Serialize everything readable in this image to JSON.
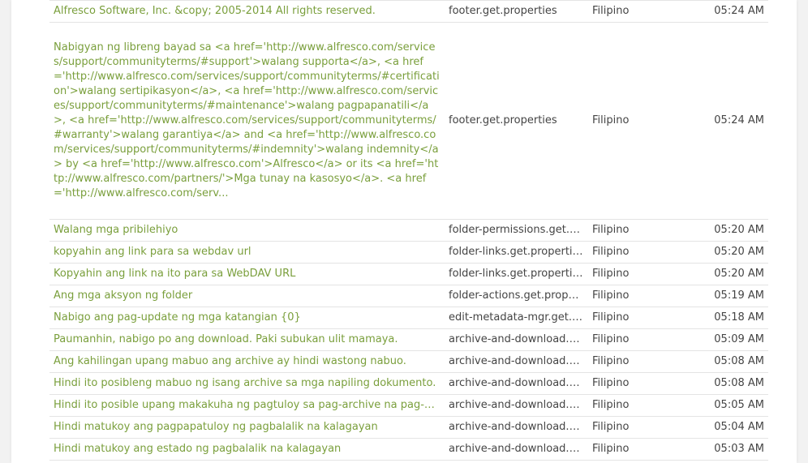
{
  "rows": [
    {
      "text": "Alfresco Software, Inc. &copy; 2005-2014 All rights reserved.",
      "bundle": "footer.get.properties",
      "language": "Filipino",
      "time": "05:24 AM"
    },
    {
      "text": "Nabigyan ng libreng bayad sa <a href='http://www.alfresco.com/services/support/communityterms/#support'>walang supporta</a>, <a href='http://www.alfresco.com/services/support/communityterms/#certification'>walang sertipikasyon</a>, <a href='http://www.alfresco.com/services/support/communityterms/#maintenance'>walang pagpapanatili</a>, <a href='http://www.alfresco.com/services/support/communityterms/#warranty'>walang garantiya</a> and <a href='http://www.alfresco.com/services/support/communityterms/#indemnity'>walang indemnity</a> by <a href='http://www.alfresco.com'>Alfresco</a> or its <a href='http://www.alfresco.com/partners/'>Mga tunay na kasosyo</a>. <a href='http://www.alfresco.com/serv...",
      "bundle": "footer.get.properties",
      "language": "Filipino",
      "time": "05:24 AM"
    },
    {
      "text": "Walang mga pribilehiyo",
      "bundle": "folder-permissions.get.pr...",
      "language": "Filipino",
      "time": "05:20 AM"
    },
    {
      "text": "kopyahin ang link para sa webdav url",
      "bundle": "folder-links.get.properties",
      "language": "Filipino",
      "time": "05:20 AM"
    },
    {
      "text": "Kopyahin ang link na ito para sa WebDAV URL",
      "bundle": "folder-links.get.properties",
      "language": "Filipino",
      "time": "05:20 AM"
    },
    {
      "text": "Ang mga aksyon ng folder",
      "bundle": "folder-actions.get.propert...",
      "language": "Filipino",
      "time": "05:19 AM"
    },
    {
      "text": "Nabigo ang pag-update ng mga katangian {0}",
      "bundle": "edit-metadata-mgr.get.pr...",
      "language": "Filipino",
      "time": "05:18 AM"
    },
    {
      "text": "Paumanhin, nabigo po ang download. Paki subukan ulit mamaya.",
      "bundle": "archive-and-download.ge...",
      "language": "Filipino",
      "time": "05:09 AM"
    },
    {
      "text": "Ang kahilingan upang mabuo ang archive ay hindi wastong nabuo.",
      "bundle": "archive-and-download.ge...",
      "language": "Filipino",
      "time": "05:08 AM"
    },
    {
      "text": "Hindi ito posibleng mabuo ng isang archive sa mga napiling dokumento.",
      "bundle": "archive-and-download.ge...",
      "language": "Filipino",
      "time": "05:08 AM"
    },
    {
      "text": "Hindi ito posible upang makakuha ng pagtuloy sa pag-archive na pag-unlad.",
      "bundle": "archive-and-download.ge...",
      "language": "Filipino",
      "time": "05:05 AM"
    },
    {
      "text": "Hindi matukoy ang pagpapatuloy ng pagbalalik na kalagayan",
      "bundle": "archive-and-download.ge...",
      "language": "Filipino",
      "time": "05:04 AM"
    },
    {
      "text": "Hindi matukoy ang estado ng pagbalalik na kalagayan",
      "bundle": "archive-and-download.ge...",
      "language": "Filipino",
      "time": "05:03 AM"
    }
  ],
  "colors": {
    "link": "#7a9f3c",
    "text": "#444444",
    "divider": "#e4e4e4"
  }
}
